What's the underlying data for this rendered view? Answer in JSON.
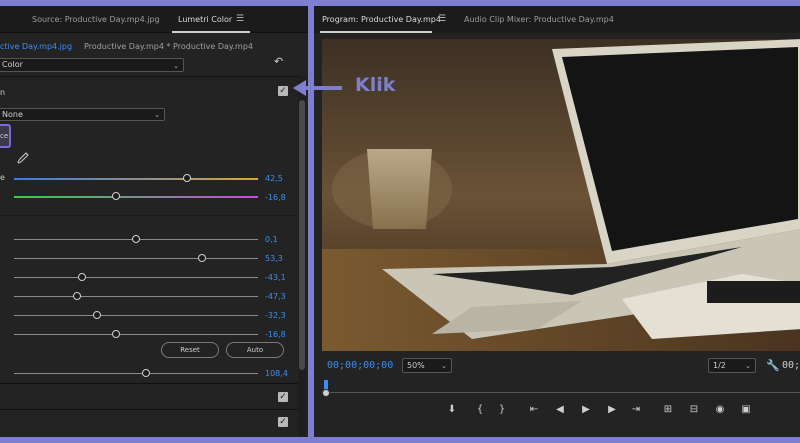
{
  "left_panel": {
    "tabs": [
      {
        "label": "Source: Productive Day.mp4.jpg",
        "active": false
      },
      {
        "label": "Lumetri Color",
        "active": true
      }
    ],
    "clip_active": "ctive Day.mp4.jpg",
    "clip_sequence": "Productive Day.mp4 * Productive Day.mp4",
    "basic_select": "Color",
    "section_label": "n",
    "lut_select": "None",
    "highlighted_button_label": "ce",
    "sliders": [
      {
        "label": "e",
        "value_text": "42,5",
        "fraction": 0.71
      },
      {
        "label": "",
        "value_text": "-16,8",
        "fraction": 0.42
      },
      {
        "label": "",
        "value_text": "0,1",
        "fraction": 0.5
      },
      {
        "label": "",
        "value_text": "53,3",
        "fraction": 0.77
      },
      {
        "label": "",
        "value_text": "-43,1",
        "fraction": 0.28
      },
      {
        "label": "",
        "value_text": "-47,3",
        "fraction": 0.26
      },
      {
        "label": "",
        "value_text": "-32,3",
        "fraction": 0.34
      },
      {
        "label": "",
        "value_text": "-16,8",
        "fraction": 0.42
      },
      {
        "label": "",
        "value_text": "108,4",
        "fraction": 0.54
      }
    ],
    "reset_label": "Reset",
    "auto_label": "Auto"
  },
  "right_panel": {
    "tabs": [
      {
        "label": "Program: Productive Day.mp4",
        "active": true
      },
      {
        "label": "Audio Clip Mixer: Productive Day.mp4",
        "active": false
      }
    ],
    "timecode": "00;00;00;00",
    "zoom": "50%",
    "resolution": "1/2",
    "timecode_right": "00;"
  },
  "annotation": {
    "text": "Klik",
    "color": "#7f7fd0"
  },
  "colors": {
    "accent_blue": "#3b8ef0",
    "frame": "#7f7fd0"
  }
}
